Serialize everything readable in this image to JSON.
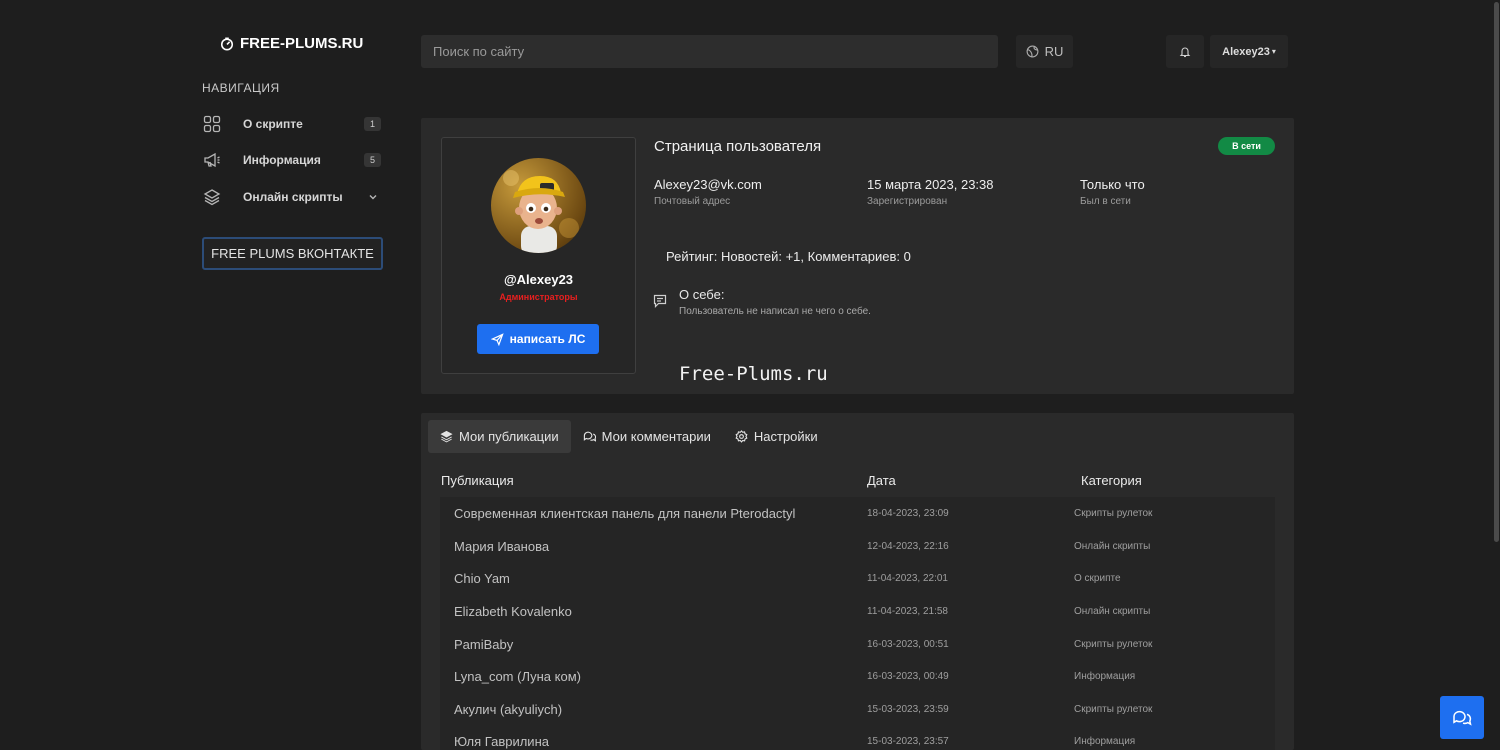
{
  "header": {
    "logo_text": "FREE-PLUMS.RU",
    "search_placeholder": "Поиск по сайту",
    "language": "RU",
    "user_menu_label": "Alexey23",
    "user_menu_caret": "▾"
  },
  "sidebar": {
    "title": "НАВИГАЦИЯ",
    "items": [
      {
        "label": "О скрипте",
        "badge": "1",
        "icon": "grid-icon"
      },
      {
        "label": "Информация",
        "badge": "5",
        "icon": "megaphone-icon"
      },
      {
        "label": "Онлайн скрипты",
        "icon": "layers-icon",
        "has_dropdown": true
      }
    ],
    "vk_button_label": "FREE PLUMS ВКОНТАКТЕ"
  },
  "profile": {
    "heading": "Страница пользователя",
    "status_badge": "В сети",
    "username": "@Alexey23",
    "role": "Администраторы",
    "pm_button_label": "написать ЛС",
    "email_value": "Alexey23@vk.com",
    "email_label": "Почтовый адрес",
    "registered_value": "15 марта 2023, 23:38",
    "registered_label": "Зарегистрирован",
    "last_seen_value": "Только что",
    "last_seen_label": "Был в сети",
    "rating": "Рейтинг: Новостей: +1, Комментариев: 0",
    "about_title": "О себе:",
    "about_text": "Пользователь не написал не чего о себе.",
    "watermark": "Free-Plums.ru"
  },
  "tabs": [
    {
      "label": "Мои публикации",
      "active": true,
      "icon": "layers-icon"
    },
    {
      "label": "Мои комментарии",
      "active": false,
      "icon": "chat-icon"
    },
    {
      "label": "Настройки",
      "active": false,
      "icon": "gear-icon"
    }
  ],
  "table": {
    "headers": [
      "Публикация",
      "Дата",
      "Категория"
    ],
    "rows": [
      {
        "title": "Современная клиентская панель для панели Pterodactyl",
        "date": "18-04-2023, 23:09",
        "category": "Скрипты рулеток"
      },
      {
        "title": "Мария Иванова",
        "date": "12-04-2023, 22:16",
        "category": "Онлайн скрипты"
      },
      {
        "title": "Chio Yam",
        "date": "11-04-2023, 22:01",
        "category": "О скрипте"
      },
      {
        "title": "Elizabeth Kovalenko",
        "date": "11-04-2023, 21:58",
        "category": "Онлайн скрипты"
      },
      {
        "title": "PamiBaby",
        "date": "16-03-2023, 00:51",
        "category": "Скрипты рулеток"
      },
      {
        "title": "Lyna_com (Луна ком)",
        "date": "16-03-2023, 00:49",
        "category": "Информация"
      },
      {
        "title": "Акулич (akyuliych)",
        "date": "15-03-2023, 23:59",
        "category": "Скрипты рулеток"
      },
      {
        "title": "Юля Гаврилина",
        "date": "15-03-2023, 23:57",
        "category": "Информация"
      }
    ]
  },
  "colors": {
    "accent": "#1e6ff0",
    "online": "#128a45",
    "role": "#e81f1f",
    "background": "#1e1e1e",
    "panel": "#2a2a2a"
  }
}
